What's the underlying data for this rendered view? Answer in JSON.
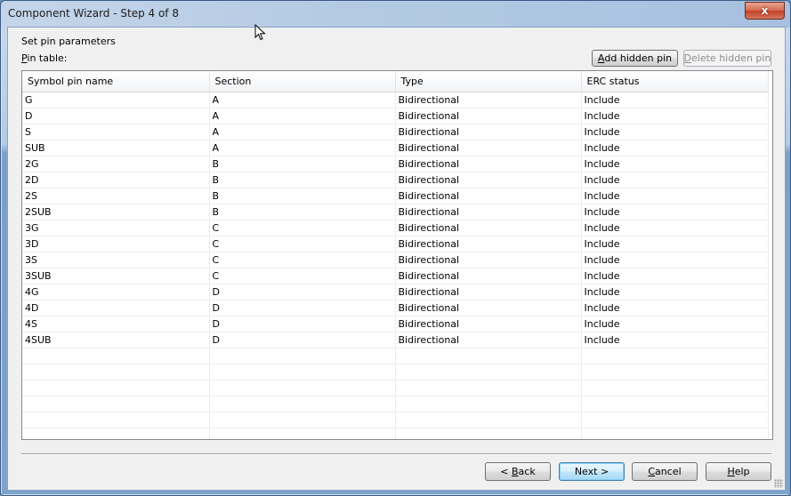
{
  "window": {
    "title": "Component Wizard - Step 4 of 8",
    "close_label": "x"
  },
  "page": {
    "heading": "Set pin parameters",
    "pin_table_label_mnemonic": "P",
    "pin_table_label_rest": "in table:"
  },
  "toolbar": {
    "add_hidden_pin_mnemonic": "A",
    "add_hidden_pin_rest": "dd hidden pin",
    "delete_hidden_pin_mnemonic": "D",
    "delete_hidden_pin_rest": "elete hidden pin"
  },
  "table": {
    "columns": [
      "Symbol pin name",
      "Section",
      "Type",
      "ERC status"
    ],
    "rows": [
      [
        "G",
        "A",
        "Bidirectional",
        "Include"
      ],
      [
        "D",
        "A",
        "Bidirectional",
        "Include"
      ],
      [
        "S",
        "A",
        "Bidirectional",
        "Include"
      ],
      [
        "SUB",
        "A",
        "Bidirectional",
        "Include"
      ],
      [
        "2G",
        "B",
        "Bidirectional",
        "Include"
      ],
      [
        "2D",
        "B",
        "Bidirectional",
        "Include"
      ],
      [
        "2S",
        "B",
        "Bidirectional",
        "Include"
      ],
      [
        "2SUB",
        "B",
        "Bidirectional",
        "Include"
      ],
      [
        "3G",
        "C",
        "Bidirectional",
        "Include"
      ],
      [
        "3D",
        "C",
        "Bidirectional",
        "Include"
      ],
      [
        "3S",
        "C",
        "Bidirectional",
        "Include"
      ],
      [
        "3SUB",
        "C",
        "Bidirectional",
        "Include"
      ],
      [
        "4G",
        "D",
        "Bidirectional",
        "Include"
      ],
      [
        "4D",
        "D",
        "Bidirectional",
        "Include"
      ],
      [
        "4S",
        "D",
        "Bidirectional",
        "Include"
      ],
      [
        "4SUB",
        "D",
        "Bidirectional",
        "Include"
      ]
    ],
    "empty_rows": 6
  },
  "footer": {
    "back_prefix": "< ",
    "back_mnemonic": "B",
    "back_rest": "ack",
    "next_label": "Next >",
    "cancel_mnemonic": "C",
    "cancel_rest": "ancel",
    "help_mnemonic": "H",
    "help_rest": "elp"
  }
}
